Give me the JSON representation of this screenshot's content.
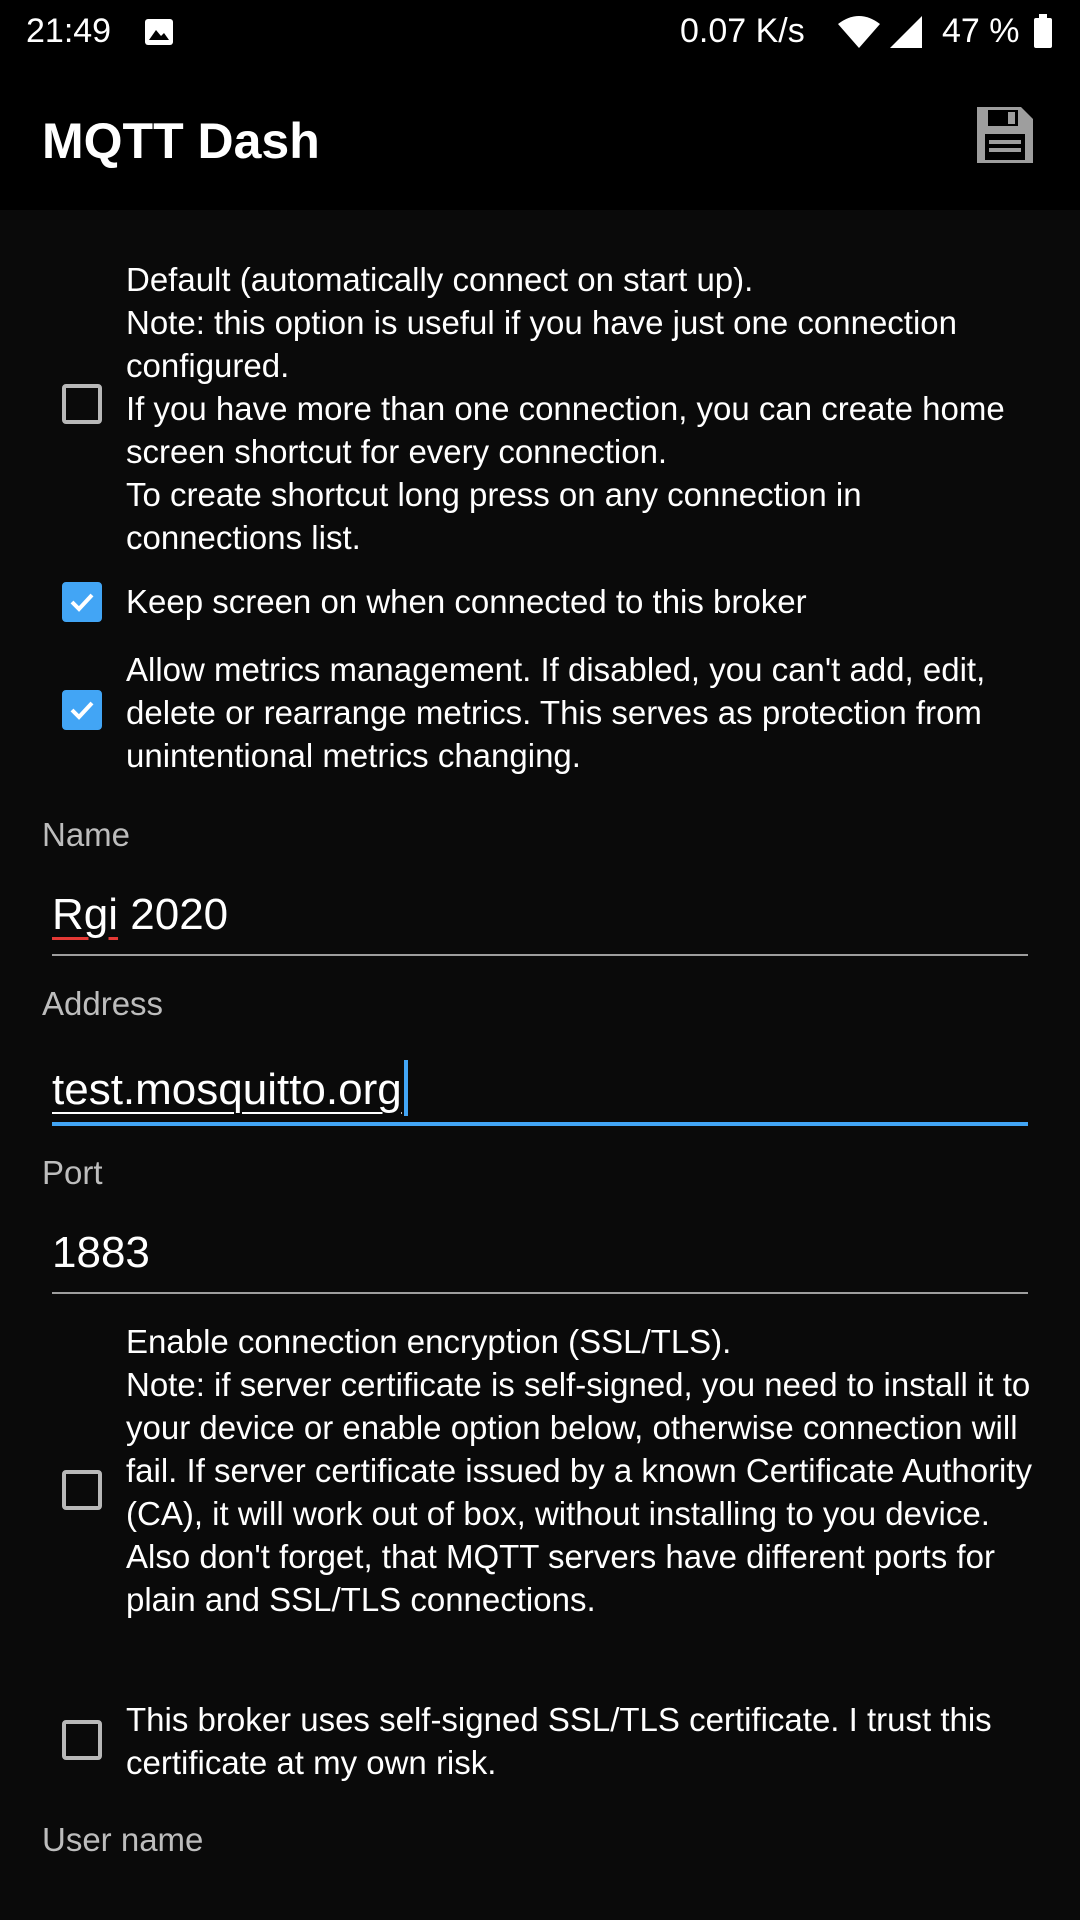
{
  "status_bar": {
    "time": "21:49",
    "speed": "0.07 K/s",
    "battery": "47 %"
  },
  "app_bar": {
    "title": "MQTT Dash",
    "save_icon": "floppy-disk-icon"
  },
  "options": {
    "default_connect": {
      "checked": false,
      "text": "Default (automatically connect on start up).\nNote: this option is useful if you have just one connection configured.\nIf you have more than one connection, you can create home screen shortcut for every connection.\nTo create shortcut long press on any connection in connections list."
    },
    "keep_screen_on": {
      "checked": true,
      "text": "Keep screen on when connected to this broker"
    },
    "allow_metrics": {
      "checked": true,
      "text": "Allow metrics management. If disabled, you can't add, edit, delete or rearrange metrics. This serves as protection from unintentional metrics changing."
    },
    "ssl": {
      "checked": false,
      "text": "Enable connection encryption (SSL/TLS).\nNote: if server certificate is self-signed, you need to install it to your device or enable option below, otherwise connection will fail. If server certificate issued by a known Certificate Authority (CA), it will work out of box, without installing to you device. Also don't forget, that MQTT servers have different ports for plain and SSL/TLS connections."
    },
    "self_signed": {
      "checked": false,
      "text": "This broker uses self-signed SSL/TLS certificate. I trust this certificate at my own risk."
    }
  },
  "fields": {
    "name": {
      "label": "Name",
      "value_word1": "Rgi",
      "value_rest": " 2020"
    },
    "address": {
      "label": "Address",
      "value": "test.mosquitto.org"
    },
    "port": {
      "label": "Port",
      "value": "1883"
    },
    "username": {
      "label": "User name"
    }
  },
  "colors": {
    "accent": "#42a5f5",
    "spell_error": "#e53935",
    "background": "#0a0a0a"
  }
}
